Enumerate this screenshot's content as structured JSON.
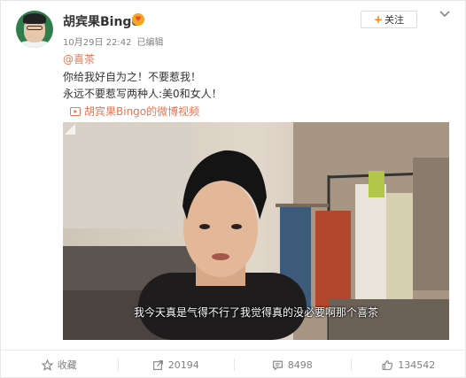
{
  "post": {
    "author": "胡宾果Bingo",
    "badge_glyph": "♥",
    "time": "10月29日 22:42",
    "edited": "已编辑",
    "follow_label": "关注",
    "follow_plus": "+",
    "topic": "@喜茶",
    "lines": [
      "你给我好自为之！不要惹我！",
      "永远不要惹写两种人:美0和女人！"
    ],
    "video_link": "胡宾果Bingo的微博视频"
  },
  "video": {
    "subtitle": "我今天真是气得不行了我觉得真的没必要啊那个喜茶"
  },
  "actions": {
    "favorite": "收藏",
    "repost": "20194",
    "comment": "8498",
    "like": "134542"
  },
  "colors": {
    "link": "#eb7350",
    "accent": "#ff8200",
    "muted": "#808080"
  }
}
